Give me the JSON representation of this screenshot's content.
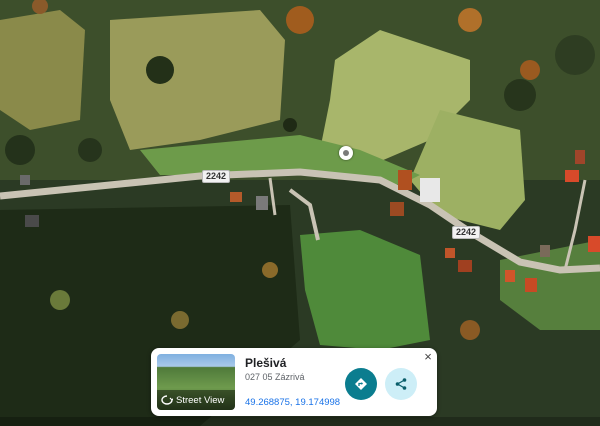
{
  "map": {
    "road_labels": [
      "2242",
      "2242"
    ],
    "pin": "location-pin-icon"
  },
  "place_card": {
    "title": "Plešivá",
    "address": "027 05 Zázrivá",
    "coordinates": "49.268875, 19.174998",
    "street_view_label": "Street View",
    "close_glyph": "×",
    "colors": {
      "directions": "#0b7d8f",
      "share": "#cdeef7",
      "link": "#1a73e8"
    }
  }
}
